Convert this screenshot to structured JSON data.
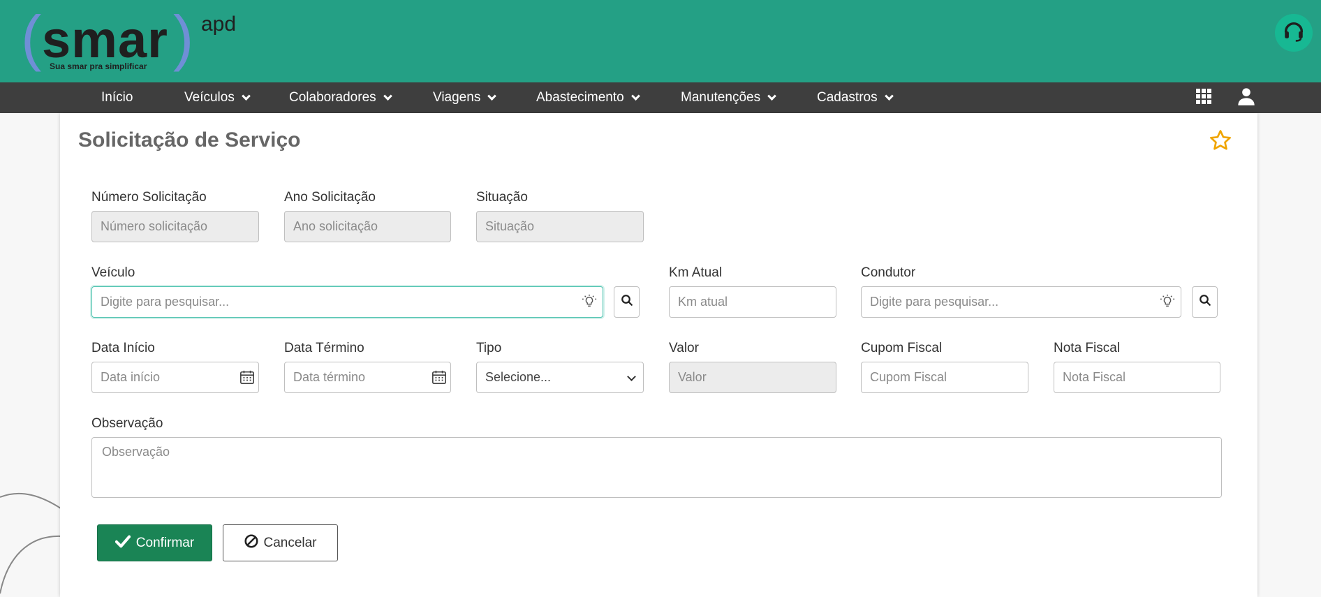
{
  "header": {
    "logo": {
      "word": "smar",
      "superscript": "apd",
      "tagline": "Sua smar pra simplificar"
    },
    "support_icon": "headset-icon"
  },
  "nav": {
    "items": [
      {
        "label": "Início",
        "has_dropdown": false
      },
      {
        "label": "Veículos",
        "has_dropdown": true
      },
      {
        "label": "Colaboradores",
        "has_dropdown": true
      },
      {
        "label": "Viagens",
        "has_dropdown": true
      },
      {
        "label": "Abastecimento",
        "has_dropdown": true
      },
      {
        "label": "Manutenções",
        "has_dropdown": true
      },
      {
        "label": "Cadastros",
        "has_dropdown": true
      }
    ],
    "right_icons": [
      "apps-grid-icon",
      "user-icon"
    ]
  },
  "page": {
    "title": "Solicitação de Serviço",
    "favorite_icon": "star-icon"
  },
  "form": {
    "numero": {
      "label": "Número Solicitação",
      "placeholder": "Número solicitação"
    },
    "ano": {
      "label": "Ano Solicitação",
      "placeholder": "Ano solicitação"
    },
    "situacao": {
      "label": "Situação",
      "placeholder": "Situação"
    },
    "veiculo": {
      "label": "Veículo",
      "placeholder": "Digite para pesquisar..."
    },
    "km": {
      "label": "Km Atual",
      "placeholder": "Km atual"
    },
    "condutor": {
      "label": "Condutor",
      "placeholder": "Digite para pesquisar..."
    },
    "data_inicio": {
      "label": "Data Início",
      "placeholder": "Data início"
    },
    "data_termino": {
      "label": "Data Término",
      "placeholder": "Data término"
    },
    "tipo": {
      "label": "Tipo",
      "selected": "Selecione..."
    },
    "valor": {
      "label": "Valor",
      "placeholder": "Valor"
    },
    "cupom": {
      "label": "Cupom Fiscal",
      "placeholder": "Cupom Fiscal"
    },
    "nota": {
      "label": "Nota Fiscal",
      "placeholder": "Nota Fiscal"
    },
    "observacao": {
      "label": "Observação",
      "placeholder": "Observação"
    }
  },
  "actions": {
    "confirm_label": "Confirmar",
    "cancel_label": "Cancelar"
  },
  "colors": {
    "header_bg": "#24a085",
    "nav_bg": "#3e3e3e",
    "confirm_bg": "#1a8455",
    "star": "#f0a500"
  }
}
